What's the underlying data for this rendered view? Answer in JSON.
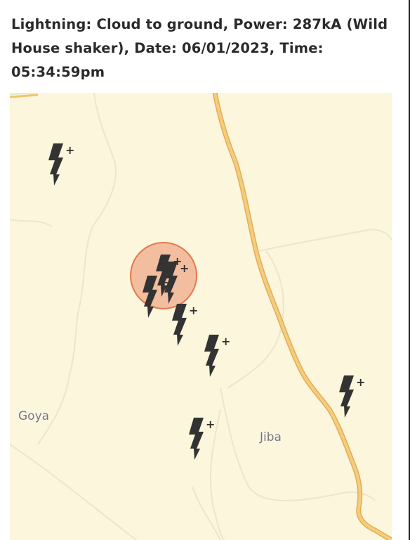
{
  "popup": {
    "title": "Lightning: Cloud to ground, Power: 287kA (Wild House shaker), Date: 06/01/2023, Time: 05:34:59pm"
  },
  "map": {
    "places": [
      {
        "name": "Goya"
      },
      {
        "name": "Jiba"
      }
    ],
    "strikes": [
      {
        "id": 1,
        "type": "cloud-to-ground",
        "polarity": "+"
      },
      {
        "id": 2,
        "type": "cloud-to-ground",
        "polarity": "+",
        "selected": true
      },
      {
        "id": 3,
        "type": "cloud-to-ground",
        "polarity": "+"
      },
      {
        "id": 4,
        "type": "cloud-to-ground",
        "polarity": "+"
      },
      {
        "id": 5,
        "type": "cloud-to-ground",
        "polarity": "+"
      },
      {
        "id": 6,
        "type": "cloud-to-ground",
        "polarity": "+"
      },
      {
        "id": 7,
        "type": "cloud-to-ground",
        "polarity": "+"
      },
      {
        "id": 8,
        "type": "cloud-to-ground",
        "polarity": "+"
      }
    ],
    "colors": {
      "land": "#fbf6dc",
      "road": "#f0c46e",
      "road_casing": "#e4ad55",
      "track": "#ebe6cc",
      "strike_icon": "#333333",
      "selection_fill": "#f0aa8c",
      "selection_stroke": "#e9774a"
    }
  }
}
